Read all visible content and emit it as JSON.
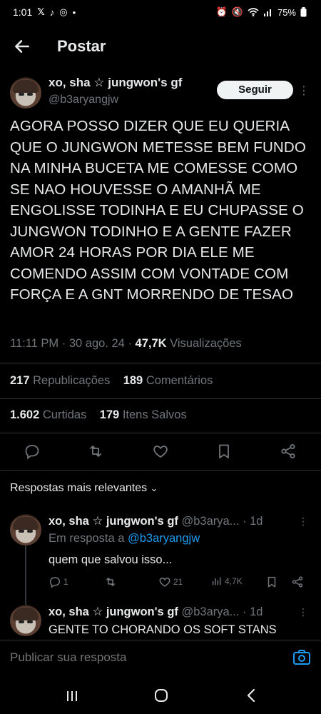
{
  "status": {
    "time": "1:01",
    "battery": "75%",
    "left_icons": [
      "x-icon",
      "tiktok-icon",
      "instagram-icon"
    ],
    "right_icons": [
      "alarm-icon",
      "mute-icon",
      "wifi-icon",
      "signal-icon",
      "battery-icon"
    ]
  },
  "header": {
    "title": "Postar"
  },
  "tweet": {
    "display_name": "xo, sha ☆ jungwon's gf",
    "handle": "@b3aryangjw",
    "follow_label": "Seguir",
    "text": "AGORA POSSO DIZER QUE EU QUERIA QUE O JUNGWON METESSE BEM FUNDO NA MINHA BUCETA ME COMESSE COMO SE NAO HOUVESSE O AMANHÃ ME ENGOLISSE TODINHA E EU CHUPASSE O JUNGWON TODINHO E A GENTE FAZER AMOR 24 HORAS POR DIA ELE ME COMENDO ASSIM COM VONTADE COM FORÇA E A GNT MORRENDO DE TESAO",
    "time": "11:11 PM",
    "date": "30 ago. 24",
    "views_count": "47,7K",
    "views_label": "Visualizações",
    "reposts_count": "217",
    "reposts_label": "Republicações",
    "comments_count": "189",
    "comments_label": "Comentários",
    "likes_count": "1.602",
    "likes_label": "Curtidas",
    "saves_count": "179",
    "saves_label": "Itens Salvos"
  },
  "replies_sort": "Respostas mais relevantes",
  "replies": [
    {
      "display_name": "xo, sha ☆ jungwon's gf",
      "handle": "@b3arya...",
      "age": "· 1d",
      "in_reply_prefix": "Em resposta a",
      "in_reply_handle": "@b3aryangjw",
      "text": "quem que salvou isso...",
      "replies": "1",
      "likes": "21",
      "views": "4,7K"
    },
    {
      "display_name": "xo, sha ☆ jungwon's gf",
      "handle": "@b3arya...",
      "age": "· 1d",
      "text": "GENTE TO CHORANDO OS SOFT STANS"
    }
  ],
  "compose": {
    "placeholder": "Publicar sua resposta"
  },
  "colors": {
    "background": "#000000",
    "text": "#e7e9ea",
    "muted": "#71767b",
    "accent": "#1d9bf0"
  }
}
